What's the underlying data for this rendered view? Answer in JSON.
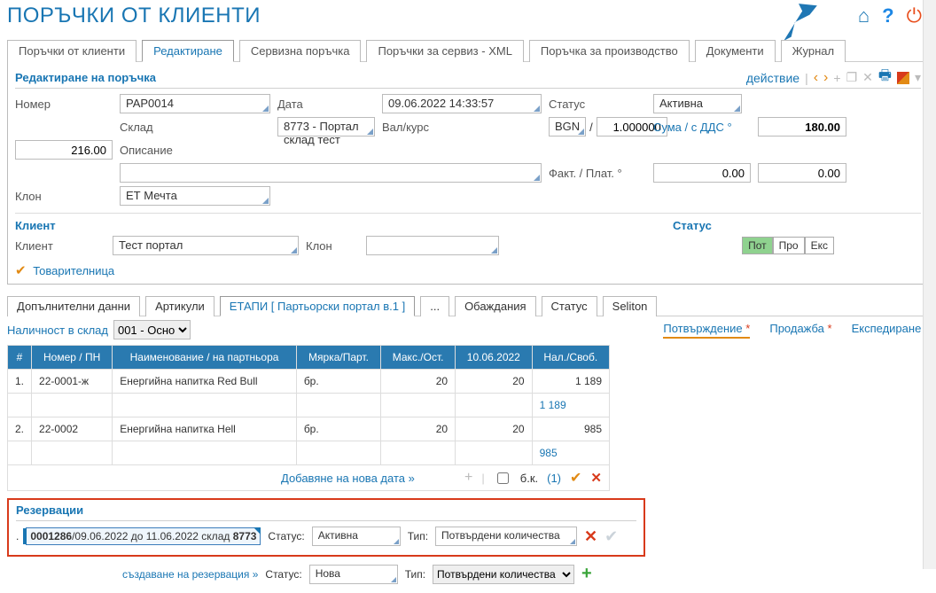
{
  "header": {
    "title": "ПОРЪЧКИ ОТ КЛИЕНТИ"
  },
  "tabs": {
    "orders": "Поръчки от клиенти",
    "edit": "Редактиране",
    "service": "Сервизна поръчка",
    "service_xml": "Поръчки за сервиз - XML",
    "production": "Поръчка за производство",
    "documents": "Документи",
    "journal": "Журнал"
  },
  "edit_panel": {
    "title": "Редактиране на поръчка",
    "action_link": "действие"
  },
  "form": {
    "labels": {
      "number": "Номер",
      "date": "Дата",
      "status": "Статус",
      "warehouse": "Склад",
      "currency": "Вал/курс",
      "sum_vat": "Сума / с ДДС",
      "description": "Описание",
      "inv_paid": "Факт. / Плат.",
      "branch": "Клон",
      "client_section": "Клиент",
      "client": "Клиент",
      "status2": "Статус"
    },
    "values": {
      "number": "PAP0014",
      "date": "09.06.2022 14:33:57",
      "status": "Активна",
      "warehouse": "8773 - Портал склад тест",
      "currency": "BGN",
      "rate": "1.000000",
      "sum": "180.00",
      "sum_vat": "216.00",
      "inv": "0.00",
      "paid": "0.00",
      "description": "",
      "branch": "ЕТ Мечта",
      "client": "Тест портал",
      "client_branch": ""
    },
    "status_tags": {
      "pot": "Пот",
      "pro": "Про",
      "eks": "Екс"
    },
    "shipment_note": "Товарителница"
  },
  "subtabs": {
    "extra": "Допълнителни данни",
    "articles": "Артикули",
    "stages": "ЕТАПИ [ Партьорски портал в.1 ]",
    "dots": "...",
    "calls": "Обаждания",
    "status": "Статус",
    "seliton": "Seliton"
  },
  "stock": {
    "label": "Наличност в склад",
    "option": "001 - Осно"
  },
  "right_links": {
    "confirm": "Потвърждение",
    "sale": "Продажба",
    "ship": "Експедиране"
  },
  "table": {
    "headers": {
      "idx": "#",
      "num": "Номер / ПН",
      "name": "Наименование / на партньора",
      "unit": "Мярка/Парт.",
      "max": "Макс./Ост.",
      "date": "10.06.2022",
      "avail": "Нал./Своб."
    },
    "rows": [
      {
        "idx": "1.",
        "num": "22-0001-ж",
        "name": "Енергийна напитка Red Bull",
        "unit": "бр.",
        "max": "20",
        "date": "20",
        "avail": "1 189",
        "sub_avail": "1 189"
      },
      {
        "idx": "2.",
        "num": "22-0002",
        "name": "Енергийна напитка Hell",
        "unit": "бр.",
        "max": "20",
        "date": "20",
        "avail": "985",
        "sub_avail": "985"
      }
    ]
  },
  "add_date": {
    "label": "Добавяне на нова дата »",
    "bk": "б.к.",
    "count": "(1)"
  },
  "reservations": {
    "title": "Резервации",
    "row_idx": ".",
    "badge_num": "0001286",
    "badge_text": "/09.06.2022 до 11.06.2022 склад",
    "badge_wh": "8773",
    "status_lbl": "Статус:",
    "status_val": "Активна",
    "type_lbl": "Тип:",
    "type_val": "Потвърдени количества"
  },
  "create_res": {
    "label": "създаване на резервация »",
    "status_lbl": "Статус:",
    "status_opt": "Нова",
    "type_lbl": "Тип:",
    "type_opt": "Потвърдени количества"
  }
}
